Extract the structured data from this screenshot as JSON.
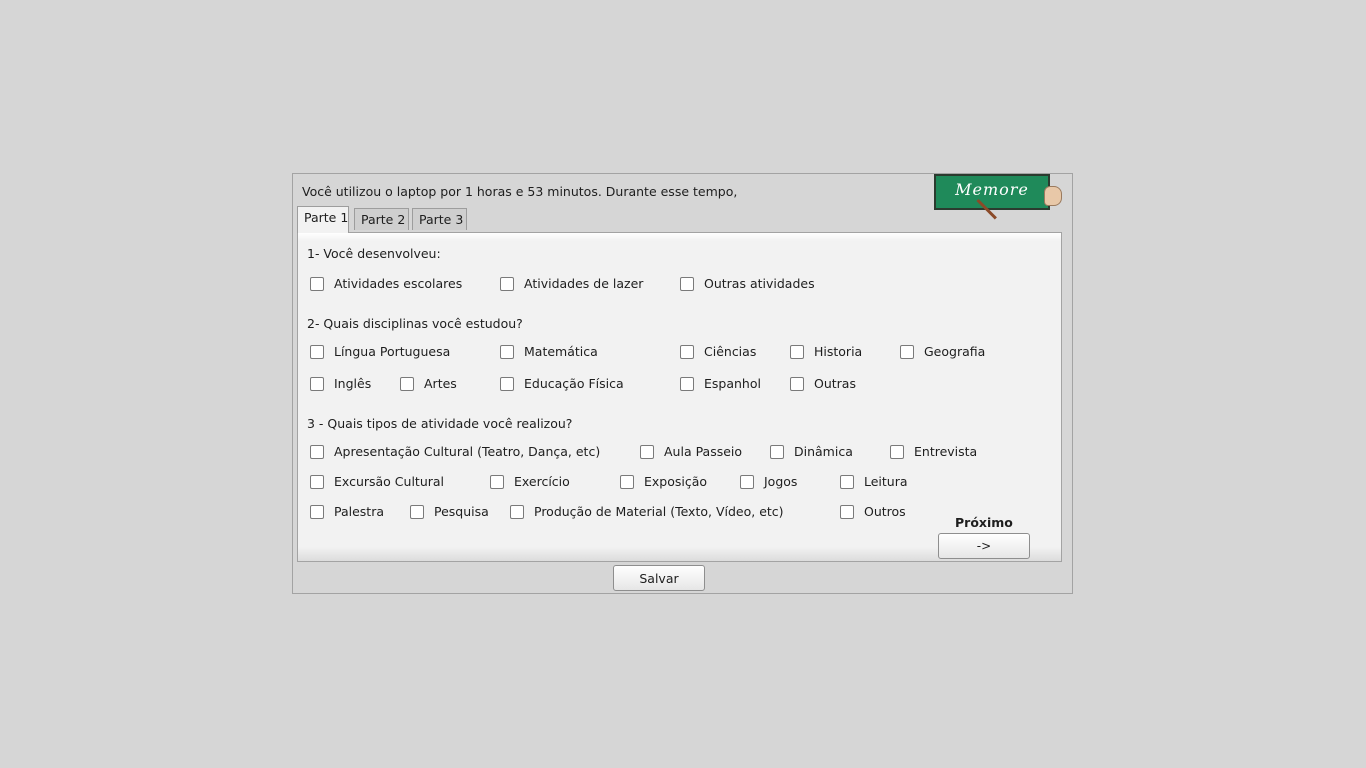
{
  "intro": "Você utilizou o laptop por 1 horas e 53 minutos. Durante esse tempo,",
  "logo": {
    "text": "Memore",
    "icon": "memore-logo-icon"
  },
  "tabs": [
    {
      "label": "Parte 1",
      "active": true
    },
    {
      "label": "Parte 2",
      "active": false
    },
    {
      "label": "Parte 3",
      "active": false
    }
  ],
  "q1": {
    "title": "1- Você desenvolveu:",
    "options": [
      "Atividades escolares",
      "Atividades de lazer",
      "Outras atividades"
    ]
  },
  "q2": {
    "title": "2- Quais disciplinas você estudou?",
    "options": [
      "Língua Portuguesa",
      "Matemática",
      "Ciências",
      "Historia",
      "Geografia",
      "Inglês",
      "Artes",
      "Educação Física",
      "Espanhol",
      "Outras"
    ]
  },
  "q3": {
    "title": "3 - Quais tipos de atividade você realizou?",
    "options": [
      "Apresentação Cultural (Teatro, Dança, etc)",
      "Aula Passeio",
      "Dinâmica",
      "Entrevista",
      "Excursão Cultural",
      "Exercício",
      "Exposição",
      "Jogos",
      "Leitura",
      "Palestra",
      "Pesquisa",
      "Produção de Material (Texto, Vídeo, etc)",
      "Outros"
    ]
  },
  "next": {
    "label": "Próximo",
    "button": "->"
  },
  "save": {
    "label": "Salvar"
  },
  "colors": {
    "background": "#d6d6d6",
    "panel": "#f2f2f2",
    "logo": "#1f8a5a"
  }
}
